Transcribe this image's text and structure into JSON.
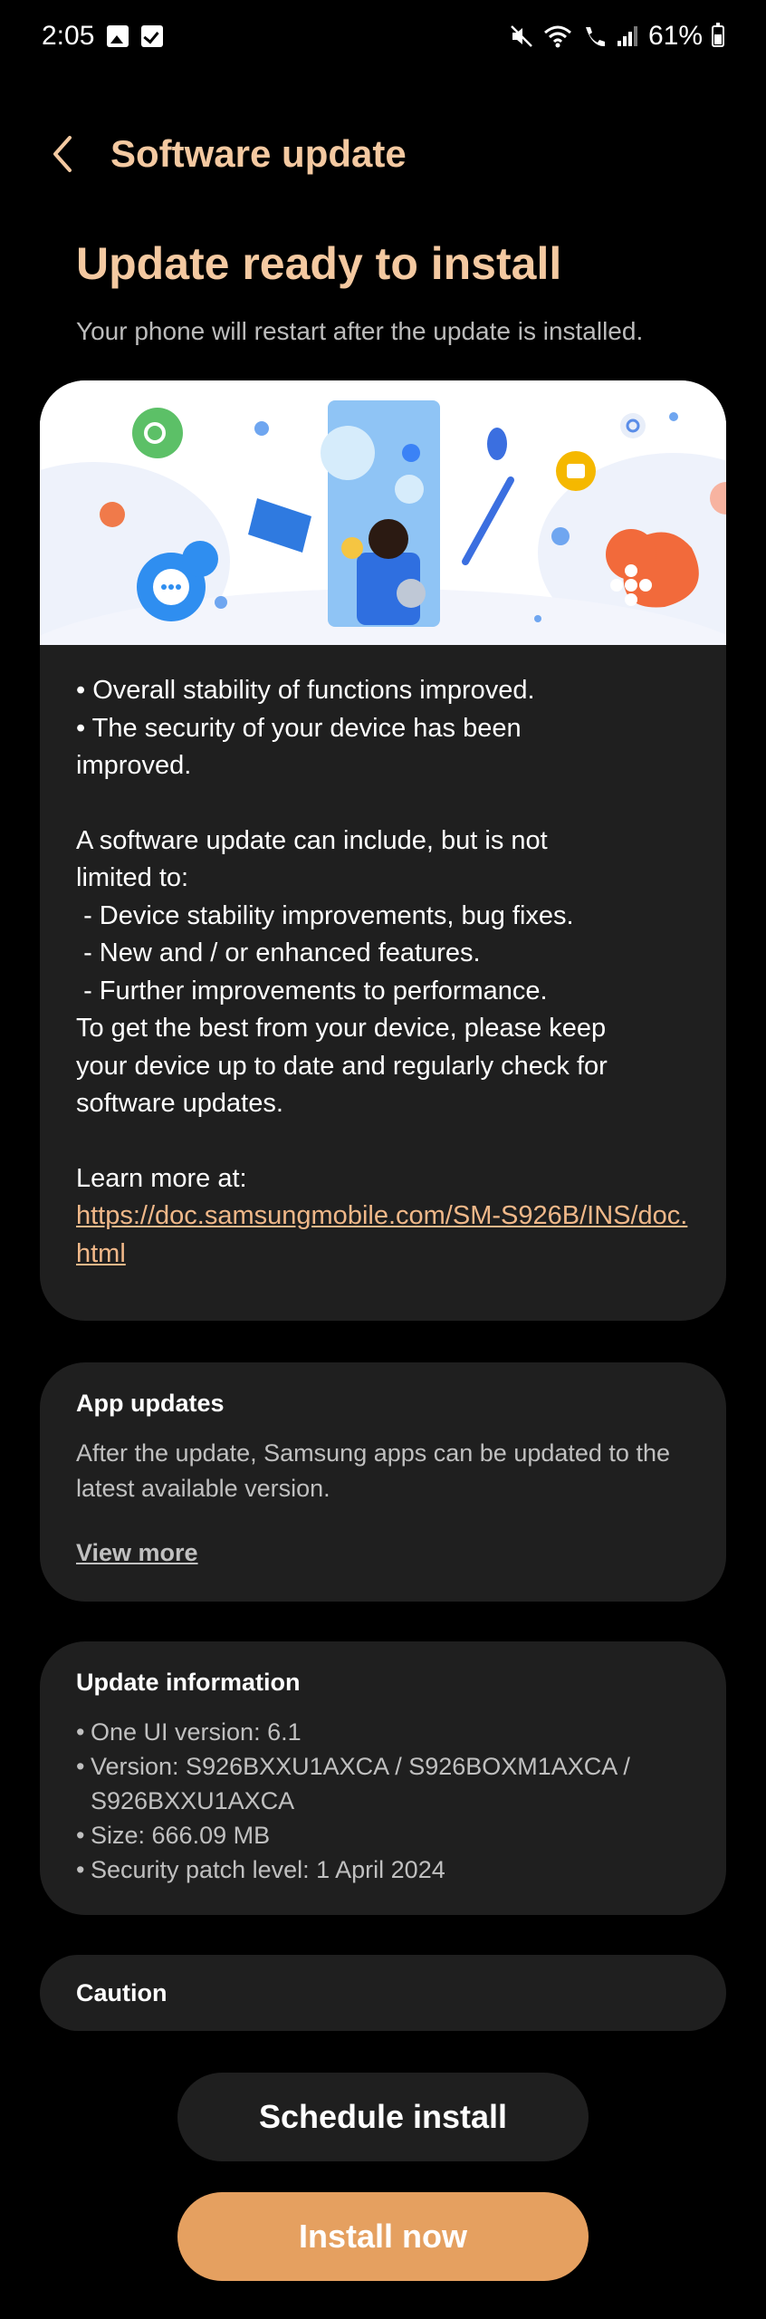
{
  "status_bar": {
    "time": "2:05",
    "battery_percent": "61%",
    "icons": [
      "photo-notification-icon",
      "checkbox-notification-icon",
      "mute-icon",
      "wifi-icon",
      "wifi-calling-icon",
      "signal-icon",
      "battery-icon"
    ]
  },
  "header": {
    "title": "Software update"
  },
  "headline": "Update ready to install",
  "subline": "Your phone will restart after the update is installed.",
  "main_card": {
    "bullets": [
      "• Overall stability of functions improved.",
      "• The security of your device has been\nimproved."
    ],
    "intro": "A software update can include, but is not\nlimited to:",
    "items": [
      " - Device stability improvements, bug fixes.",
      " - New and / or enhanced features.",
      " - Further improvements to performance."
    ],
    "advice": "To get the best from your device, please keep\nyour device up to date and regularly check for\nsoftware updates.",
    "learn_more_label": "Learn more at:",
    "link": "https://doc.samsungmobile.com/SM-S926B/INS/doc.html"
  },
  "app_updates": {
    "title": "App updates",
    "body": "After the update, Samsung apps can be updated to the latest available version.",
    "view_more": "View more"
  },
  "update_info": {
    "title": "Update information",
    "items": [
      "One UI version: 6.1",
      "Version: S926BXXU1AXCA / S926BOXM1AXCA / S926BXXU1AXCA",
      "Size: 666.09 MB",
      "Security patch level: 1 April 2024"
    ]
  },
  "caution": {
    "title": "Caution"
  },
  "buttons": {
    "schedule": "Schedule install",
    "install": "Install now"
  },
  "colors": {
    "accent": "#f4c9a1",
    "install_button": "#e5a060",
    "card_bg": "#1f1f1f",
    "link": "#f0b889"
  }
}
